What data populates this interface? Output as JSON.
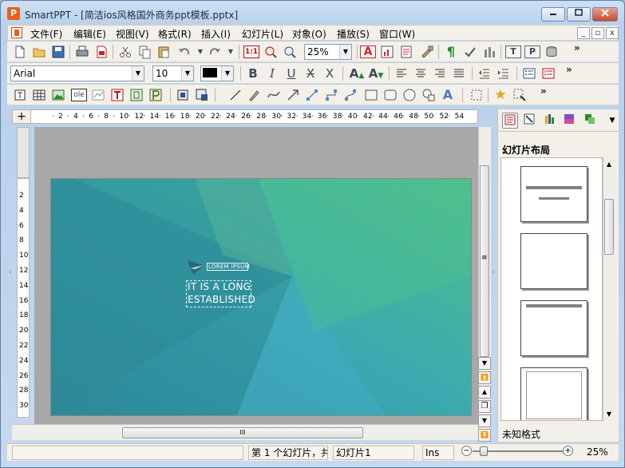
{
  "window": {
    "title": "SmartPPT - [简洁ios风格国外商务ppt模板.pptx]",
    "app_icon": "P",
    "min_icon": "minimize-icon",
    "max_icon": "maximize-icon",
    "close_icon": "close-icon"
  },
  "menubar": {
    "items": [
      "文件(F)",
      "编辑(E)",
      "视图(V)",
      "格式(R)",
      "插入(I)",
      "幻灯片(L)",
      "对象(O)",
      "播放(S)",
      "窗口(W)"
    ],
    "mdi_buttons": [
      "_",
      "▫",
      "x"
    ]
  },
  "toolbar1": {
    "icons": [
      "new-document-icon",
      "open-folder-icon",
      "save-icon",
      "print-icon",
      "export-pdf-icon",
      "cut-icon",
      "copy-icon",
      "paste-icon",
      "undo-icon",
      "redo-icon",
      "actual-size-icon",
      "zoom-fit-icon",
      "zoom-icon",
      "text-color-icon",
      "insert-chart-icon",
      "notes-icon",
      "format-brush-icon",
      "paragraph-mark-icon",
      "spell-check-icon",
      "statistics-icon",
      "slide-icon",
      "presentation-icon",
      "database-icon"
    ],
    "actual_size_label": "1:1",
    "zoom_value": "25%",
    "more": "»"
  },
  "toolbar2": {
    "font": "Arial",
    "size": "10",
    "color": "#000000",
    "style_labels": [
      "B",
      "I",
      "U",
      "X",
      "X"
    ],
    "align_icons": [
      "align-left-icon",
      "align-center-icon",
      "align-right-icon",
      "justify-icon"
    ],
    "more": "»"
  },
  "toolbar3": {
    "icons": [
      "text-frame-icon",
      "table-icon",
      "picture-icon",
      "ole-object-icon",
      "chart-icon",
      "text-box-icon",
      "frame-icon",
      "placeholder-icon",
      "group-icon",
      "ungroup-icon",
      "line-icon",
      "pen-icon",
      "curve-icon",
      "arrow-icon",
      "connector-icon",
      "elbow-connector-icon",
      "connector2-icon",
      "rectangle-icon",
      "rounded-rectangle-icon",
      "ellipse-icon",
      "shapes-icon",
      "wordart-icon",
      "align-objects-icon",
      "star-icon",
      "animation-icon"
    ],
    "ole_label": "ole",
    "more": "»"
  },
  "ruler": {
    "h_numbers": [
      "2",
      "4",
      "6",
      "8",
      "10",
      "12",
      "14",
      "16",
      "18",
      "20",
      "22",
      "24",
      "26",
      "28",
      "30",
      "32",
      "34",
      "36",
      "38",
      "40",
      "42",
      "44",
      "46",
      "48",
      "50",
      "52",
      "54"
    ],
    "v_numbers": [
      "2",
      "4",
      "6",
      "8",
      "10",
      "12",
      "14",
      "16",
      "18",
      "20",
      "22",
      "24",
      "26",
      "28",
      "30"
    ]
  },
  "slide": {
    "label": "LOREM IPSUM",
    "heading_line1": "IT IS A LONG",
    "heading_line2": "ESTABLISHED",
    "colors": {
      "teal": "#2e9c9a",
      "green": "#4dc28b",
      "blue": "#42a9c8"
    }
  },
  "panel": {
    "tabs": [
      "slide-tab-icon",
      "outline-tab-icon",
      "layout-tab-icon",
      "design-tab-icon",
      "animation-tab-icon"
    ],
    "title": "幻灯片布局",
    "status": "未知格式"
  },
  "statusbar": {
    "message": "",
    "slide_info": "第 1 个幻灯片，共",
    "slide_name": "幻灯片1",
    "mode": "Ins",
    "zoom": "25%",
    "zoom_level": 0.12
  },
  "scrollbar": {
    "hthumb_grip": "III",
    "vthumb_grip": "≡"
  }
}
